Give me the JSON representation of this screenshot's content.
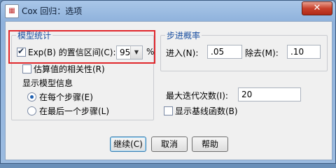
{
  "window": {
    "title": "Cox 回归：选项",
    "close_glyph": "✕",
    "app_icon": "spss-icon"
  },
  "model_stats": {
    "legend": "模型统计",
    "exp_ci_label": "Exp(B) 的置信区间(C):",
    "exp_ci_checked": true,
    "ci_value": "95",
    "ci_unit": "%",
    "corr_label": "估算值的相关性(R)",
    "corr_checked": false,
    "display_label": "显示模型信息",
    "radio_each": "在每个步骤(E)",
    "radio_last": "在最后一个步骤(L)",
    "selected_radio": "each"
  },
  "stepwise": {
    "legend": "步进概率",
    "entry_label": "进入(N):",
    "entry_value": ".05",
    "removal_label": "除去(M):",
    "removal_value": ".10"
  },
  "max_iter": {
    "label": "最大迭代次数(I):",
    "value": "20"
  },
  "baseline": {
    "label": "显示基线函数(B)",
    "checked": false
  },
  "buttons": {
    "continue": "继续(C)",
    "cancel": "取消",
    "help": "帮助"
  },
  "colors": {
    "highlight": "#e0262b",
    "legend": "#1a4fa0",
    "radio_dot": "#1e5fb0"
  }
}
